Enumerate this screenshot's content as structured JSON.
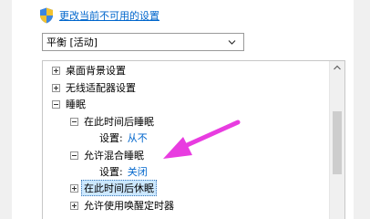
{
  "change_settings_link": "更改当前不可用的设置",
  "power_plan": {
    "selected": "平衡 [活动]"
  },
  "tree": {
    "desktop_background": "桌面背景设置",
    "wireless_adapter": "无线适配器设置",
    "sleep": {
      "label": "睡眠",
      "sleep_after": {
        "label": "在此时间后睡眠",
        "setting_label": "设置:",
        "setting_value": "从不"
      },
      "hybrid_sleep": {
        "label": "允许混合睡眠",
        "setting_label": "设置:",
        "setting_value": "关闭"
      },
      "hibernate_after": {
        "label": "在此时间后休眠"
      },
      "wake_timers": {
        "label": "允许使用唤醒定时器"
      }
    }
  },
  "colors": {
    "link": "#0066cc",
    "selection": "#cce8ff",
    "annotation_arrow": "#e83ce0"
  },
  "icons": {
    "link_icon": "uac-shield-icon",
    "dropdown": "chevron-down-icon"
  }
}
